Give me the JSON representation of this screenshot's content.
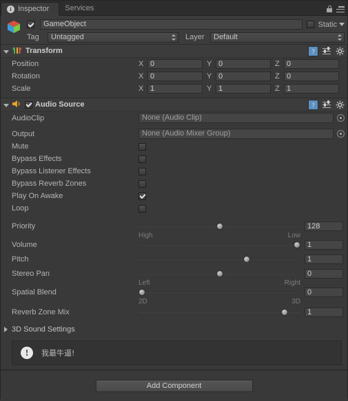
{
  "window": {
    "tabs": [
      {
        "label": "Inspector",
        "icon": "info-icon",
        "active": true
      },
      {
        "label": "Services",
        "icon": "",
        "active": false
      }
    ],
    "lock_icon": "lock-icon",
    "menu_icon": "hamburger-menu-icon"
  },
  "object_header": {
    "prefab_icon": "gameobject-cube-icon",
    "enabled": true,
    "name": "GameObject",
    "static_label": "Static",
    "static_checked": false,
    "tag_label": "Tag",
    "tag_value": "Untagged",
    "layer_label": "Layer",
    "layer_value": "Default"
  },
  "transform": {
    "title": "Transform",
    "icon": "transform-icon",
    "expanded": true,
    "help_icon": "help-icon",
    "preset_icon": "preset-icon",
    "gear_icon": "gear-icon",
    "rows": [
      {
        "label": "Position",
        "x": "0",
        "y": "0",
        "z": "0"
      },
      {
        "label": "Rotation",
        "x": "0",
        "y": "0",
        "z": "0"
      },
      {
        "label": "Scale",
        "x": "1",
        "y": "1",
        "z": "1"
      }
    ],
    "axis_labels": [
      "X",
      "Y",
      "Z"
    ]
  },
  "audio_source": {
    "title": "Audio Source",
    "icon": "audio-source-speaker-icon",
    "expanded": true,
    "enabled": true,
    "help_icon": "help-icon",
    "preset_icon": "preset-icon",
    "gear_icon": "gear-icon",
    "object_fields": [
      {
        "label": "AudioClip",
        "value": "None (Audio Clip)",
        "picker": "object-picker-icon"
      },
      {
        "label": "Output",
        "value": "None (Audio Mixer Group)",
        "picker": "object-picker-icon"
      }
    ],
    "toggles": [
      {
        "label": "Mute",
        "checked": false
      },
      {
        "label": "Bypass Effects",
        "checked": false
      },
      {
        "label": "Bypass Listener Effects",
        "checked": false
      },
      {
        "label": "Bypass Reverb Zones",
        "checked": false
      },
      {
        "label": "Play On Awake",
        "checked": true
      },
      {
        "label": "Loop",
        "checked": false
      }
    ],
    "sliders": [
      {
        "label": "Priority",
        "value": "128",
        "percent": 50,
        "left_label": "High",
        "right_label": "Low"
      },
      {
        "label": "Volume",
        "value": "1",
        "percent": 100,
        "left_label": "",
        "right_label": ""
      },
      {
        "label": "Pitch",
        "value": "1",
        "percent": 67,
        "left_label": "",
        "right_label": ""
      },
      {
        "label": "Stereo Pan",
        "value": "0",
        "percent": 50,
        "left_label": "Left",
        "right_label": "Right"
      },
      {
        "label": "Spatial Blend",
        "value": "0",
        "percent": 0,
        "left_label": "2D",
        "right_label": "3D"
      },
      {
        "label": "Reverb Zone Mix",
        "value": "1",
        "percent": 90,
        "left_label": "",
        "right_label": ""
      }
    ],
    "sound_settings": {
      "label": "3D Sound Settings",
      "expanded": false
    },
    "help_box": {
      "icon": "warning-icon",
      "text": "我最牛逼!"
    }
  },
  "footer": {
    "add_component_label": "Add Component"
  },
  "colors": {
    "background": "#393939",
    "header": "#3c3c3c",
    "field": "#454545",
    "text": "#b4b4b4",
    "help_blue": "#5d8fc0"
  }
}
